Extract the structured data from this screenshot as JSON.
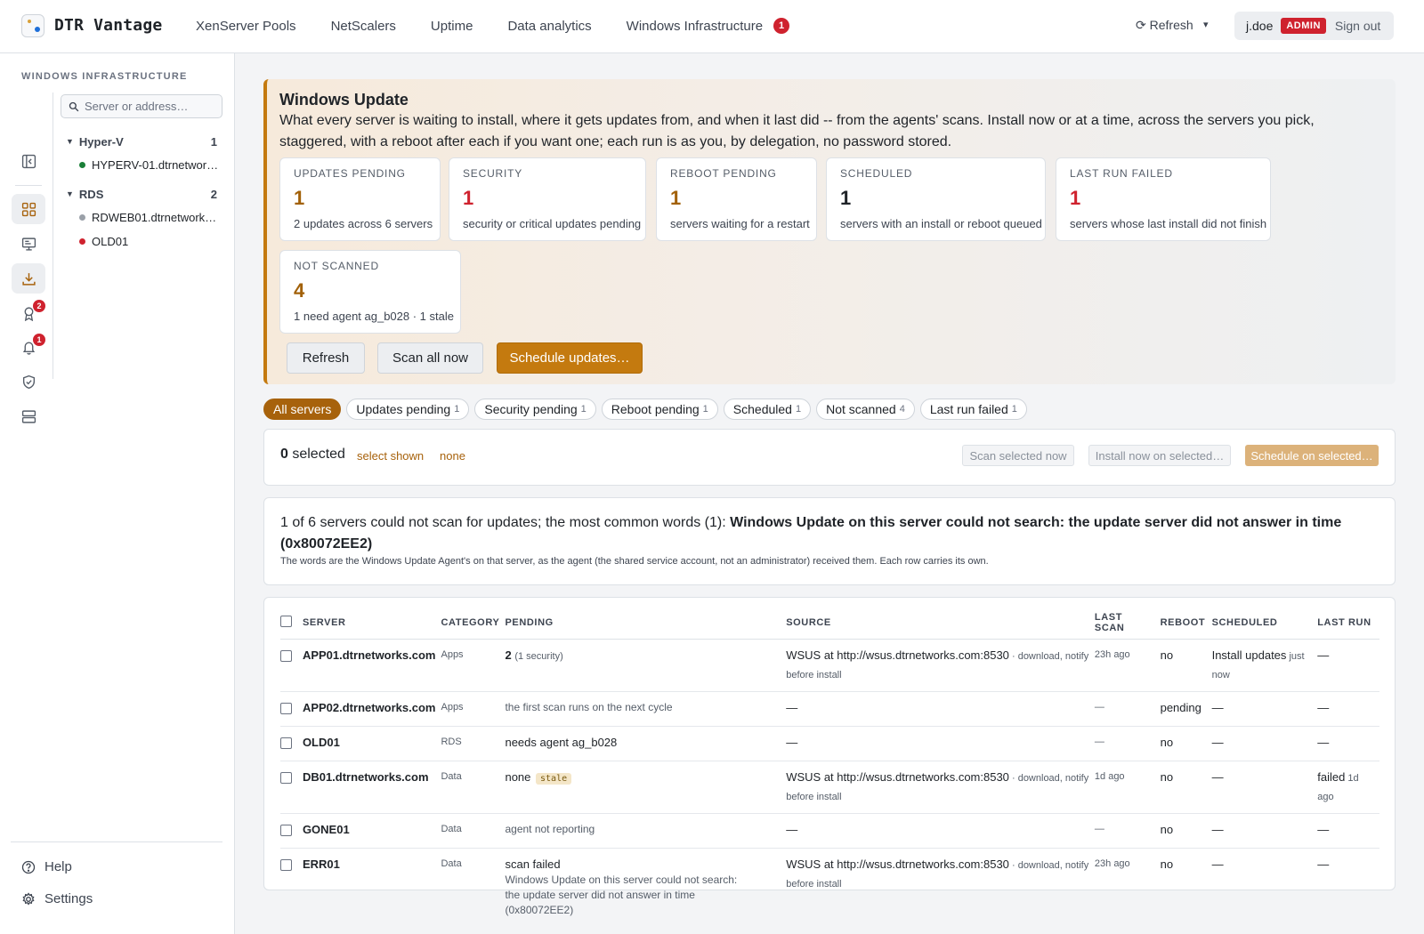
{
  "app": {
    "title": "DTR Vantage"
  },
  "topnav": [
    {
      "label": "XenServer Pools"
    },
    {
      "label": "NetScalers"
    },
    {
      "label": "Uptime"
    },
    {
      "label": "Data analytics"
    },
    {
      "label": "Windows Infrastructure",
      "badge": "1"
    }
  ],
  "topbar": {
    "refresh": "⟳ Refresh",
    "caret": "▾",
    "user": "j.doe",
    "role": "ADMIN",
    "signout": "Sign out"
  },
  "sidebar": {
    "title": "WINDOWS INFRASTRUCTURE",
    "search_placeholder": "Server or address…",
    "rail_badges": {
      "ribbon": "2",
      "bell": "1"
    },
    "groups": [
      {
        "name": "Hyper-V",
        "count": "1",
        "items": [
          {
            "name": "HYPERV-01.dtrnetworks.com",
            "status": "green"
          }
        ]
      },
      {
        "name": "RDS",
        "count": "2",
        "items": [
          {
            "name": "RDWEB01.dtrnetworks.com",
            "status": "gray"
          },
          {
            "name": "OLD01",
            "status": "red"
          }
        ]
      }
    ],
    "footer": {
      "help": "Help",
      "settings": "Settings"
    }
  },
  "hero": {
    "title": "Windows Update",
    "description": "What every server is waiting to install, where it gets updates from, and when it last did -- from the agents' scans. Install now or at a time, across the servers you pick, staggered, with a reboot after each if you want one; each run is as you, by delegation, no password stored.",
    "cards": [
      {
        "label": "UPDATES PENDING",
        "value": "1",
        "sub": "2 updates across 6 servers"
      },
      {
        "label": "SECURITY",
        "value": "1",
        "sub": "security or critical updates pending"
      },
      {
        "label": "REBOOT PENDING",
        "value": "1",
        "sub": "servers waiting for a restart"
      },
      {
        "label": "SCHEDULED",
        "value": "1",
        "sub": "servers with an install or reboot queued"
      },
      {
        "label": "LAST RUN FAILED",
        "value": "1",
        "sub": "servers whose last install did not finish"
      },
      {
        "label": "NOT SCANNED",
        "value": "4",
        "sub": "1 need agent ag_b028 · 1 stale"
      }
    ],
    "buttons": {
      "refresh": "Refresh",
      "scan_all": "Scan all now",
      "schedule": "Schedule updates…"
    }
  },
  "filters": [
    {
      "label": "All servers",
      "count": ""
    },
    {
      "label": "Updates pending",
      "count": "1"
    },
    {
      "label": "Security pending",
      "count": "1"
    },
    {
      "label": "Reboot pending",
      "count": "1"
    },
    {
      "label": "Scheduled",
      "count": "1"
    },
    {
      "label": "Not scanned",
      "count": "4"
    },
    {
      "label": "Last run failed",
      "count": "1"
    }
  ],
  "selection": {
    "count": "0",
    "suffix": " selected",
    "select_shown": "select shown",
    "none": "none",
    "scan_selected": "Scan selected now",
    "install_selected": "Install now on selected…",
    "schedule_selected": "Schedule on selected…"
  },
  "warning": {
    "lead": "1 of 6 servers could not scan for updates; the most common words (1): ",
    "message": "Windows Update on this server could not search: the update server did not answer in time (0x80072EE2)",
    "note": "The words are the Windows Update Agent's on that server, as the agent (the shared service account, not an administrator) received them. Each row carries its own."
  },
  "table": {
    "headers": {
      "server": "SERVER",
      "category": "CATEGORY",
      "pending": "PENDING",
      "source": "SOURCE",
      "last_scan": "LAST SCAN",
      "reboot": "REBOOT",
      "scheduled": "SCHEDULED",
      "last_run": "LAST RUN"
    },
    "rows": [
      {
        "server": "APP01.dtrnetworks.com",
        "category": "Apps",
        "pending_main": "2",
        "pending_sub": "(1 security)",
        "source_main": "WSUS at http://wsus.dtrnetworks.com:8530",
        "source_sub": " · download, notify",
        "source_tail": "before install",
        "last_scan": "23h ago",
        "reboot": "no",
        "scheduled_main": "Install updates",
        "scheduled_sub": " just now",
        "last_run_main": "—",
        "last_run_sub": ""
      },
      {
        "server": "APP02.dtrnetworks.com",
        "category": "Apps",
        "pending_note": "the first scan runs on the next cycle",
        "source_main": "—",
        "last_scan": "—",
        "reboot": "pending",
        "scheduled_main": "—",
        "last_run_main": "—"
      },
      {
        "server": "OLD01",
        "category": "RDS",
        "pending_main": "needs agent ag_b028",
        "source_main": "—",
        "last_scan": "—",
        "reboot": "no",
        "scheduled_main": "—",
        "last_run_main": "—"
      },
      {
        "server": "DB01.dtrnetworks.com",
        "category": "Data",
        "pending_main": "none",
        "pending_badge": "stale",
        "source_main": "WSUS at http://wsus.dtrnetworks.com:8530",
        "source_sub": " · download, notify",
        "source_tail": "before install",
        "last_scan": "1d ago",
        "reboot": "no",
        "scheduled_main": "—",
        "last_run_main": "failed",
        "last_run_sub": " 1d ago"
      },
      {
        "server": "GONE01",
        "category": "Data",
        "pending_note": "agent not reporting",
        "source_main": "—",
        "last_scan": "—",
        "reboot": "no",
        "scheduled_main": "—",
        "last_run_main": "—"
      },
      {
        "server": "ERR01",
        "category": "Data",
        "pending_main": "scan failed",
        "pending_detail": "Windows Update on this server could not search: the update server did not answer in time (0x80072EE2)",
        "source_main": "WSUS at http://wsus.dtrnetworks.com:8530",
        "source_sub": " · download, notify",
        "source_tail": "before install",
        "last_scan": "23h ago",
        "reboot": "no",
        "scheduled_main": "—",
        "last_run_main": "—"
      }
    ]
  },
  "colors": {
    "amber": "#c47a0f",
    "amber_text": "#a26109",
    "red": "#cf222e",
    "green": "#1a7f37",
    "dark": "#1f2328"
  }
}
